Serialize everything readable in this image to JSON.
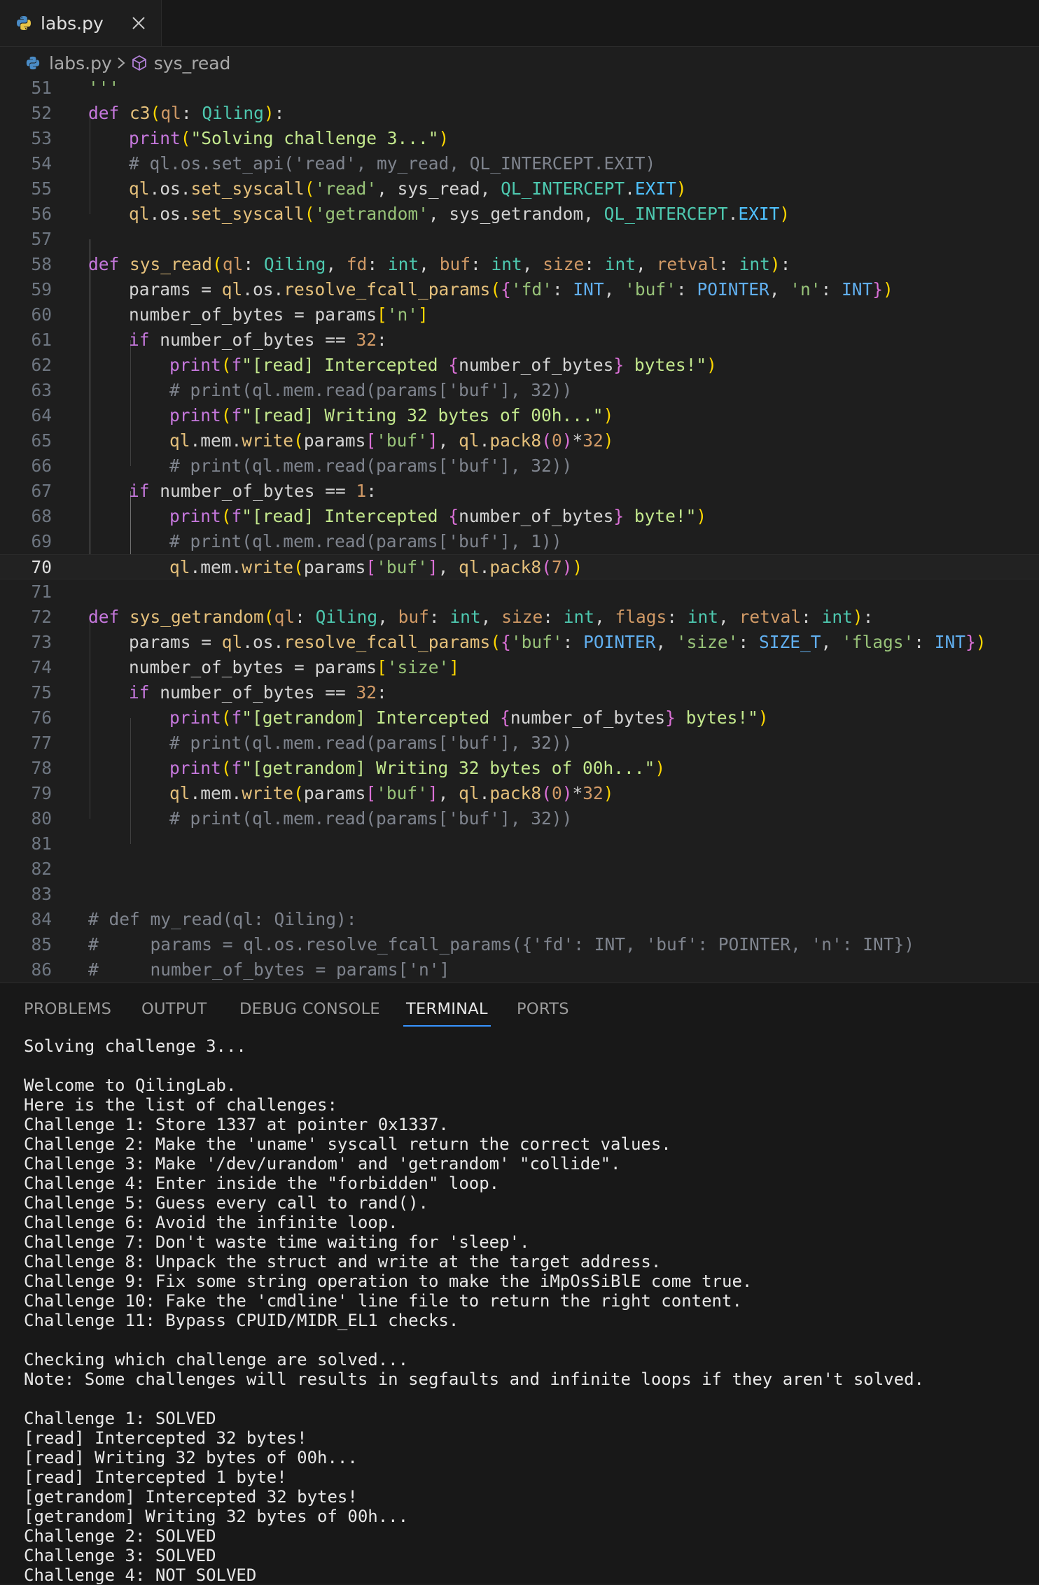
{
  "tab": {
    "filename": "labs.py",
    "close": "×"
  },
  "breadcrumb": {
    "file": "labs.py",
    "symbol": "sys_read"
  },
  "editor": {
    "current_line": "70",
    "line_numbers": [
      "51",
      "52",
      "53",
      "54",
      "55",
      "56",
      "57",
      "58",
      "59",
      "60",
      "61",
      "62",
      "63",
      "64",
      "65",
      "66",
      "67",
      "68",
      "69",
      "70",
      "71",
      "72",
      "73",
      "74",
      "75",
      "76",
      "77",
      "78",
      "79",
      "80",
      "81",
      "82",
      "83",
      "84",
      "85",
      "86"
    ],
    "code": [
      "'''",
      "def c3(ql: Qiling):",
      "print(\"Solving challenge 3...\")",
      "# ql.os.set_api('read', my_read, QL_INTERCEPT.EXIT)",
      "ql.os.set_syscall('read', sys_read, QL_INTERCEPT.EXIT)",
      "ql.os.set_syscall('getrandom', sys_getrandom, QL_INTERCEPT.EXIT)",
      "",
      "def sys_read(ql: Qiling, fd: int, buf: int, size: int, retval: int):",
      "params = ql.os.resolve_fcall_params({'fd': INT, 'buf': POINTER, 'n': INT})",
      "number_of_bytes = params['n']",
      "if number_of_bytes == 32:",
      "print(f\"[read] Intercepted {number_of_bytes} bytes!\")",
      "# print(ql.mem.read(params['buf'], 32))",
      "print(f\"[read] Writing 32 bytes of 00h...\")",
      "ql.mem.write(params['buf'], ql.pack8(0)*32)",
      "# print(ql.mem.read(params['buf'], 32))",
      "if number_of_bytes == 1:",
      "print(f\"[read] Intercepted {number_of_bytes} byte!\")",
      "# print(ql.mem.read(params['buf'], 1))",
      "ql.mem.write(params['buf'], ql.pack8(7))",
      "",
      "def sys_getrandom(ql: Qiling, buf: int, size: int, flags: int, retval: int):",
      "params = ql.os.resolve_fcall_params({'buf': POINTER, 'size': SIZE_T, 'flags': INT})",
      "number_of_bytes = params['size']",
      "if number_of_bytes == 32:",
      "print(f\"[getrandom] Intercepted {number_of_bytes} bytes!\")",
      "# print(ql.mem.read(params['buf'], 32))",
      "print(f\"[getrandom] Writing 32 bytes of 00h...\")",
      "ql.mem.write(params['buf'], ql.pack8(0)*32)",
      "# print(ql.mem.read(params['buf'], 32))",
      "",
      "",
      "",
      "# def my_read(ql: Qiling):",
      "#     params = ql.os.resolve_fcall_params({'fd': INT, 'buf': POINTER, 'n': INT})",
      "#     number_of_bytes = params['n']"
    ]
  },
  "panel": {
    "tabs": [
      "PROBLEMS",
      "OUTPUT",
      "DEBUG CONSOLE",
      "TERMINAL",
      "PORTS"
    ],
    "active_tab": "TERMINAL",
    "terminal_lines": [
      "Solving challenge 3...",
      "",
      "Welcome to QilingLab.",
      "Here is the list of challenges:",
      "Challenge 1: Store 1337 at pointer 0x1337.",
      "Challenge 2: Make the 'uname' syscall return the correct values.",
      "Challenge 3: Make '/dev/urandom' and 'getrandom' \"collide\".",
      "Challenge 4: Enter inside the \"forbidden\" loop.",
      "Challenge 5: Guess every call to rand().",
      "Challenge 6: Avoid the infinite loop.",
      "Challenge 7: Don't waste time waiting for 'sleep'.",
      "Challenge 8: Unpack the struct and write at the target address.",
      "Challenge 9: Fix some string operation to make the iMpOsSiBlE come true.",
      "Challenge 10: Fake the 'cmdline' line file to return the right content.",
      "Challenge 11: Bypass CPUID/MIDR_EL1 checks.",
      "",
      "Checking which challenge are solved...",
      "Note: Some challenges will results in segfaults and infinite loops if they aren't solved.",
      "",
      "Challenge 1: SOLVED",
      "[read] Intercepted 32 bytes!",
      "[read] Writing 32 bytes of 00h...",
      "[read] Intercepted 1 byte!",
      "[getrandom] Intercepted 32 bytes!",
      "[getrandom] Writing 32 bytes of 00h...",
      "Challenge 2: SOLVED",
      "Challenge 3: SOLVED",
      "Challenge 4: NOT SOLVED"
    ]
  },
  "colors": {
    "background": "#1e1e1e",
    "panel": "#181818",
    "accent": "#3794ff"
  }
}
